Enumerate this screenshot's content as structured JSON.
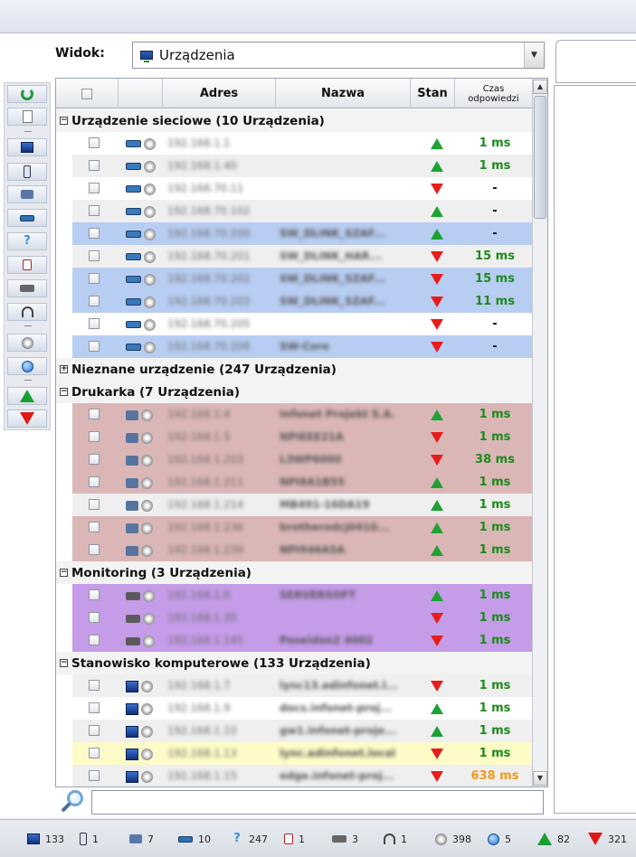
{
  "view": {
    "label": "Widok:",
    "selected": "Urządzenia"
  },
  "columns": {
    "address": "Adres",
    "name": "Nazwa",
    "state": "Stan",
    "response_line1": "Czas",
    "response_line2": "odpowiedzi"
  },
  "groups": [
    {
      "title": "Urządzenie sieciowe (10 Urządzenia)",
      "expanded": true,
      "icon": "switch-icon",
      "rows": [
        {
          "address": "192.168.1.1",
          "name": "",
          "state": "up",
          "time": "1 ms",
          "bg": "#ffffff"
        },
        {
          "address": "192.168.1.40",
          "name": "",
          "state": "up",
          "time": "1 ms",
          "bg": "#efefef"
        },
        {
          "address": "192.168.70.11",
          "name": "",
          "state": "down",
          "time": "-",
          "bg": "#ffffff"
        },
        {
          "address": "192.168.70.102",
          "name": "",
          "state": "up",
          "time": "-",
          "bg": "#efefef"
        },
        {
          "address": "192.168.70.200",
          "name": "SW_DLINK_SZAF...",
          "state": "up",
          "time": "-",
          "bg": "#b8cdf2"
        },
        {
          "address": "192.168.70.201",
          "name": "SW_DLINK_HAR...",
          "state": "down",
          "time": "15 ms",
          "bg": "#efefef"
        },
        {
          "address": "192.168.70.202",
          "name": "SW_DLINK_SZAF...",
          "state": "down",
          "time": "15 ms",
          "bg": "#b8cdf2"
        },
        {
          "address": "192.168.70.203",
          "name": "SW_DLINK_SZAF...",
          "state": "down",
          "time": "11 ms",
          "bg": "#b8cdf2"
        },
        {
          "address": "192.168.70.205",
          "name": "",
          "state": "down",
          "time": "-",
          "bg": "#ffffff"
        },
        {
          "address": "192.168.70.208",
          "name": "SW-Core",
          "state": "down",
          "time": "-",
          "bg": "#b8cdf2"
        }
      ]
    },
    {
      "title": "Nieznane urządzenie (247 Urządzenia)",
      "expanded": false,
      "rows": []
    },
    {
      "title": "Drukarka (7 Urządzenia)",
      "expanded": true,
      "icon": "printer-icon",
      "rows": [
        {
          "address": "192.168.1.4",
          "name": "Infonet Projekt S.A.",
          "state": "up",
          "time": "1 ms",
          "bg": "#dbb6b6"
        },
        {
          "address": "192.168.1.5",
          "name": "NPIEEE21A",
          "state": "down",
          "time": "1 ms",
          "bg": "#dbb6b6"
        },
        {
          "address": "192.168.1.203",
          "name": "L3WP6000",
          "state": "down",
          "time": "38 ms",
          "bg": "#dbb6b6"
        },
        {
          "address": "192.168.1.211",
          "name": "NPI8A1B55",
          "state": "up",
          "time": "1 ms",
          "bg": "#dbb6b6"
        },
        {
          "address": "192.168.1.214",
          "name": "MB491-16DA19",
          "state": "up",
          "time": "1 ms",
          "bg": "#efefef"
        },
        {
          "address": "192.168.1.236",
          "name": "brotherndcj0410...",
          "state": "up",
          "time": "1 ms",
          "bg": "#dbb6b6"
        },
        {
          "address": "192.168.1.239",
          "name": "NPI946A5A",
          "state": "up",
          "time": "1 ms",
          "bg": "#dbb6b6"
        }
      ]
    },
    {
      "title": "Monitoring (3 Urządzenia)",
      "expanded": true,
      "icon": "camera-icon",
      "rows": [
        {
          "address": "192.168.1.6",
          "name": "SERVERSOFT",
          "state": "up",
          "time": "1 ms",
          "bg": "#c59ce8"
        },
        {
          "address": "192.168.1.35",
          "name": "",
          "state": "down",
          "time": "1 ms",
          "bg": "#c59ce8"
        },
        {
          "address": "192.168.1.145",
          "name": "Poseidon2 4002",
          "state": "down",
          "time": "1 ms",
          "bg": "#c59ce8"
        }
      ]
    },
    {
      "title": "Stanowisko komputerowe (133 Urządzenia)",
      "expanded": true,
      "icon": "monitor-icon",
      "rows": [
        {
          "address": "192.168.1.7",
          "name": "lync13.adinfonet.l...",
          "state": "down",
          "time": "1 ms",
          "bg": "#efefef"
        },
        {
          "address": "192.168.1.9",
          "name": "docs.infonet-proj...",
          "state": "up",
          "time": "1 ms",
          "bg": "#ffffff"
        },
        {
          "address": "192.168.1.10",
          "name": "gw1.infonet-proje...",
          "state": "up",
          "time": "1 ms",
          "bg": "#efefef"
        },
        {
          "address": "192.168.1.13",
          "name": "lync.adinfonet.local",
          "state": "down",
          "time": "1 ms",
          "bg": "#fdfcc8"
        },
        {
          "address": "192.168.1.15",
          "name": "edge.infonet-proj...",
          "state": "down",
          "time": "638 ms",
          "bg": "#efefef"
        }
      ]
    }
  ],
  "statusbar": [
    {
      "icon": "monitor-icon",
      "count": "133"
    },
    {
      "icon": "phone-icon",
      "count": "1"
    },
    {
      "icon": "printer-icon",
      "count": "7"
    },
    {
      "icon": "switch-icon",
      "count": "10"
    },
    {
      "icon": "question-icon",
      "count": "247"
    },
    {
      "icon": "badge-icon",
      "count": "1"
    },
    {
      "icon": "camera-icon",
      "count": "3"
    },
    {
      "icon": "headset-icon",
      "count": "1"
    },
    {
      "icon": "disc-icon",
      "count": "398"
    },
    {
      "icon": "globe-icon",
      "count": "5"
    },
    {
      "icon": "arrow-up-icon",
      "count": "82"
    },
    {
      "icon": "arrow-down-icon",
      "count": "321"
    }
  ],
  "colors": {
    "time_ok": "#1c8a1c",
    "time_slow": "#f09a16",
    "state_up": "#1ea234",
    "state_down": "#e81c1c"
  }
}
